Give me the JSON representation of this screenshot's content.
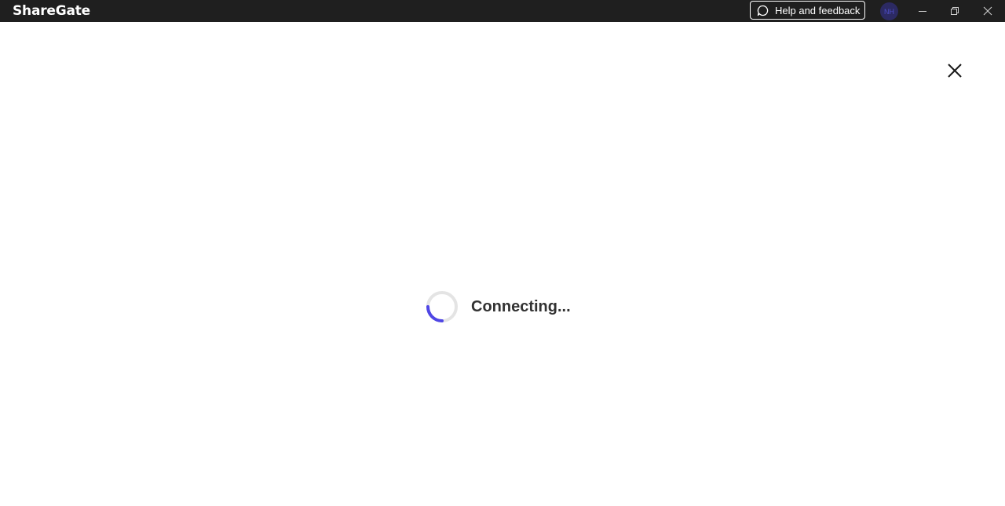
{
  "app": {
    "logo_text": "ShareGate"
  },
  "titlebar": {
    "help_label": "Help and feedback",
    "avatar_initials": "NH",
    "avatar_color": "#2c2a63"
  },
  "status": {
    "text": "Connecting...",
    "spinner_color": "#4f46e5"
  },
  "icons": {
    "help": "chat-bubble-icon",
    "minimize": "minimize-icon",
    "restore": "restore-icon",
    "close_window": "close-icon",
    "close_dialog": "close-icon",
    "spinner": "loading-spinner-icon"
  }
}
